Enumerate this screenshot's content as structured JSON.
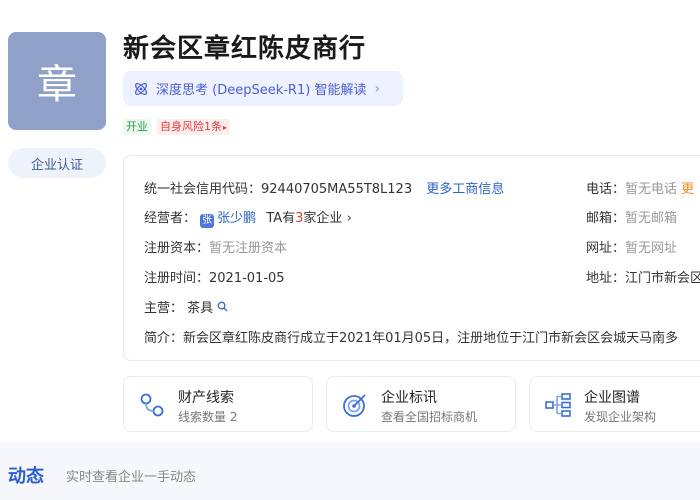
{
  "logo": {
    "char": "章"
  },
  "cert_label": "企业认证",
  "company_name": "新会区章红陈皮商行",
  "ai": {
    "label": "深度思考 (DeepSeek-R1) 智能解读",
    "chevron": "›"
  },
  "tags": {
    "status": "开业",
    "risk": "自身风险1条",
    "risk_arrow": "▸"
  },
  "info": {
    "credit_label": "统一社会信用代码：",
    "credit_value": "92440705MA55T8L123",
    "more_link": "更多工商信息",
    "operator_label": "经营者：",
    "operator_avatar": "张",
    "operator_name": "张少鹏",
    "ta_prefix": "TA有",
    "ta_count": "3",
    "ta_suffix": "家企业",
    "ta_chev": "›",
    "capital_label": "注册资本：",
    "capital_value": "暂无注册资本",
    "reg_time_label": "注册时间：",
    "reg_time_value": "2021-01-05",
    "main_label": "主营：",
    "main_value": "茶具",
    "intro_label": "简介：",
    "intro_value": "新会区章红陈皮商行成立于2021年01月05日，注册地位于江门市新会区会城天马南多",
    "phone_label": "电话：",
    "phone_value": "暂无电话",
    "phone_more": "更",
    "email_label": "邮箱：",
    "email_value": "暂无邮箱",
    "site_label": "网址：",
    "site_value": "暂无网址",
    "addr_label": "地址：",
    "addr_value": "江门市新会区"
  },
  "cards": [
    {
      "title": "财产线索",
      "sub": "线索数量 2",
      "icon": "property-clue-icon"
    },
    {
      "title": "企业标讯",
      "sub": "查看全国招标商机",
      "icon": "bid-target-icon"
    },
    {
      "title": "企业图谱",
      "sub": "发现企业架构",
      "icon": "org-chart-icon"
    }
  ],
  "dynamics": {
    "title": "动态",
    "subtitle": "实时查看企业一手动态"
  },
  "colors": {
    "accent": "#2f64c7",
    "logo_bg": "#8fa0c9",
    "ai_text": "#4a5fd6",
    "risk_red": "#e23c3c",
    "status_green": "#22a347"
  }
}
